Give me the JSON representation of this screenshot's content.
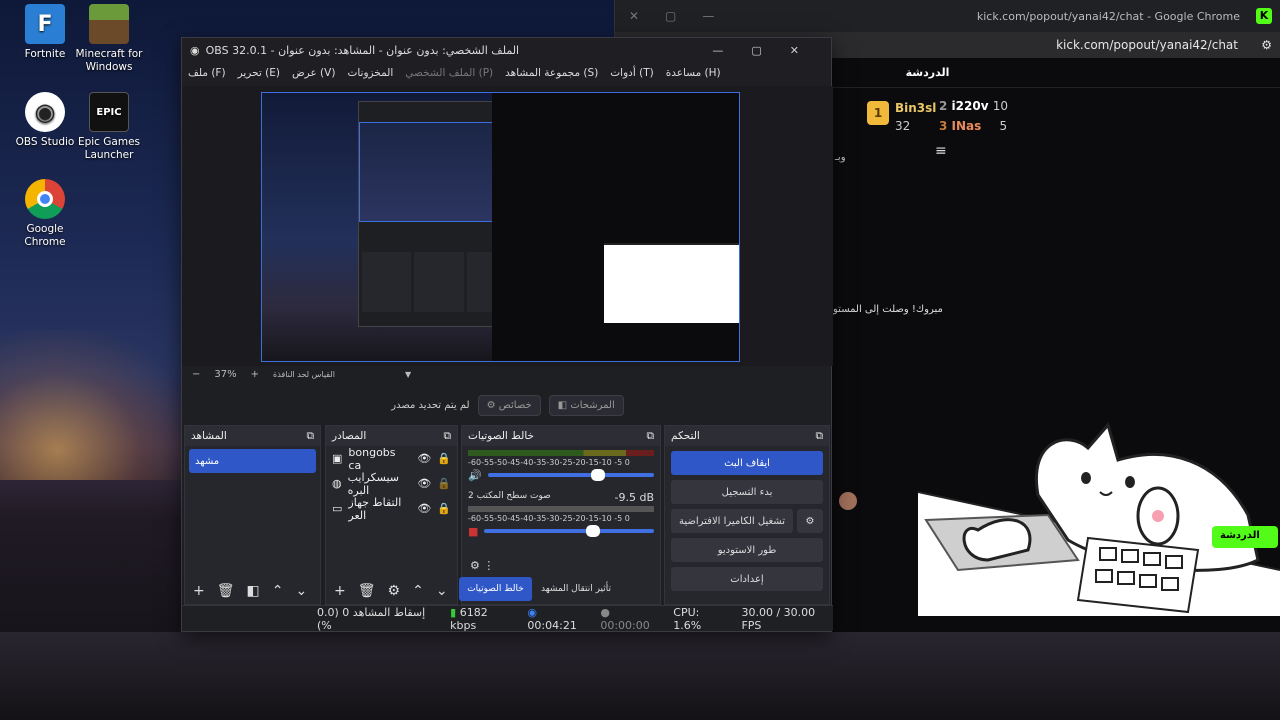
{
  "desktop": {
    "icons": [
      {
        "label": "Fortnite",
        "color": "#2a7fd4",
        "glyph": "F"
      },
      {
        "label": "Minecraft for Windows",
        "color": "#5a8a3a",
        "glyph": "■"
      },
      {
        "label": "OBS Studio",
        "color": "#222",
        "glyph": "◉"
      },
      {
        "label": "Epic Games Launcher",
        "color": "#111",
        "glyph": "EPIC"
      },
      {
        "label": "Google Chrome",
        "color": "#fff",
        "glyph": "◎"
      }
    ]
  },
  "chrome": {
    "page_title": "kick.com/popout/yanai42/chat - Google Chrome",
    "url": "kick.com/popout/yanai42/chat",
    "chat_title": "الدردشة",
    "leaders": [
      {
        "rank": "1",
        "name": "Bin3sl",
        "count": "32"
      },
      {
        "rank": "2",
        "name": "i220v",
        "count": "10"
      },
      {
        "rank": "3",
        "name": "INas",
        "count": "5"
      }
    ],
    "msg_partial": "وبـ",
    "msg_level": "!مبروك! وصلت إلى المستو",
    "chat_badge": "الدردشة"
  },
  "obs": {
    "title": "OBS 32.0.1 - الملف الشخصي: بدون عنوان - المشاهد: بدون عنوان",
    "menu": [
      "ملف (F)",
      "تحرير (E)",
      "عرض (V)",
      "المخزونات",
      "الملف الشخصي (P)",
      "مجموعة المشاهد (S)",
      "أدوات (T)",
      "مساعدة (H)"
    ],
    "zoom": "37%",
    "scale_label": "القياس لحد النافذة",
    "no_source": "لم يتم تحديد مصدر",
    "props_btn": "خصائص",
    "filters_btn": "المرشحات",
    "docks": {
      "scenes": "المشاهد",
      "sources": "المصادر",
      "mixer": "خالط الصوتيات",
      "controls": "التحكم"
    },
    "scene_items": [
      "مشهد"
    ],
    "source_items": [
      "bongobs ca",
      "سيسكرايب البره",
      "التقاط جهاز العر"
    ],
    "mixer": {
      "scale": "-60-55-50-45-40-35-30-25-20-15-10 -5 0",
      "ch2_name": "صوت سطح المكتب 2",
      "ch2_db": "-9.5 dB",
      "tab_mixer": "خالط الصوتيات",
      "tab_transition": "تأثير انتقال المشهد"
    },
    "controls": [
      "ايقاف البث",
      "بدء التسجيل",
      "تشغيل الكاميرا الافتراضية",
      "طور الاستوديو",
      "إعدادات"
    ],
    "status": {
      "dropped": "إسقاط المشاهد 0 (0.0 %)",
      "kbps": "6182 kbps",
      "live_time": "00:04:21",
      "rec_time": "00:00:00",
      "cpu": "CPU: 1.6%",
      "fps": "30.00 / 30.00 FPS"
    }
  }
}
